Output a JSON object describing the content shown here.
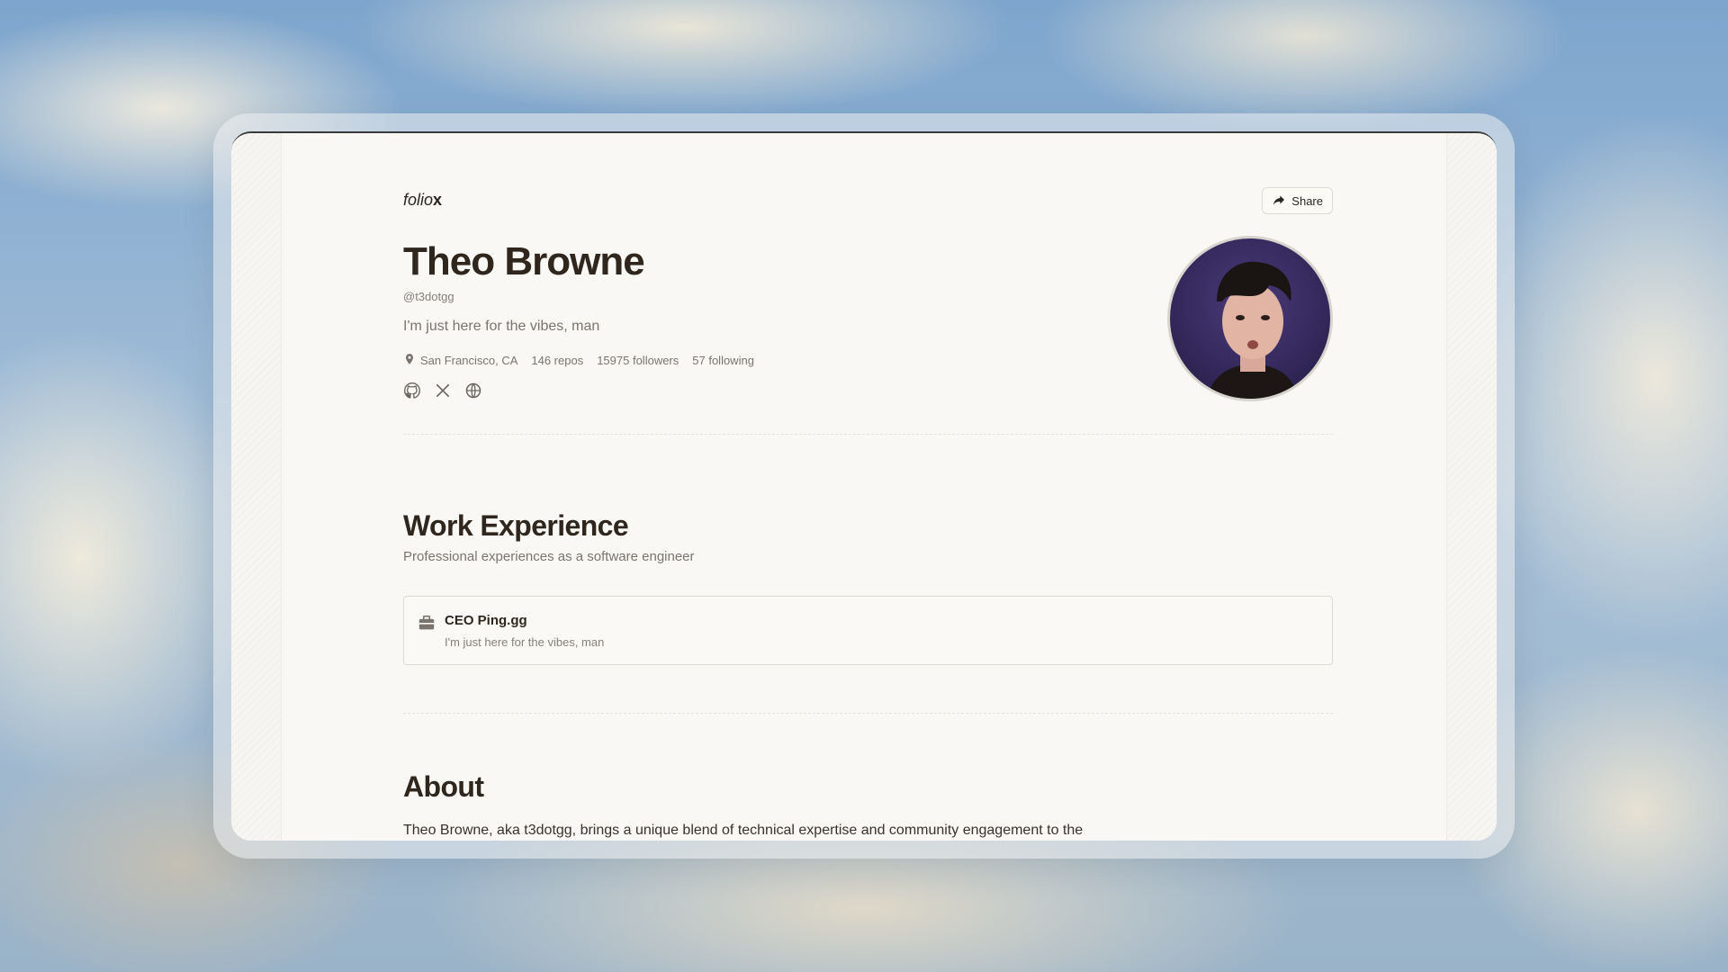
{
  "brand": {
    "prefix": "folio",
    "suffix": "x"
  },
  "share": {
    "label": "Share"
  },
  "profile": {
    "name": "Theo Browne",
    "handle": "@t3dotgg",
    "bio": "I'm just here for the vibes, man",
    "location": "San Francisco, CA",
    "repos": "146 repos",
    "followers": "15975 followers",
    "following": "57 following",
    "socials": [
      "github-icon",
      "x-icon",
      "globe-icon"
    ]
  },
  "work": {
    "title": "Work Experience",
    "subtitle": "Professional experiences as a software engineer",
    "jobs": [
      {
        "title": "CEO Ping.gg",
        "description": "I'm just here for the vibes, man"
      }
    ]
  },
  "about": {
    "title": "About",
    "text": "Theo Browne, aka t3dotgg, brings a unique blend of technical expertise and community engagement to the"
  },
  "colors": {
    "accent_text": "#2f261d",
    "muted_text": "#7a746d",
    "window_bg": "#f9f8f5"
  }
}
